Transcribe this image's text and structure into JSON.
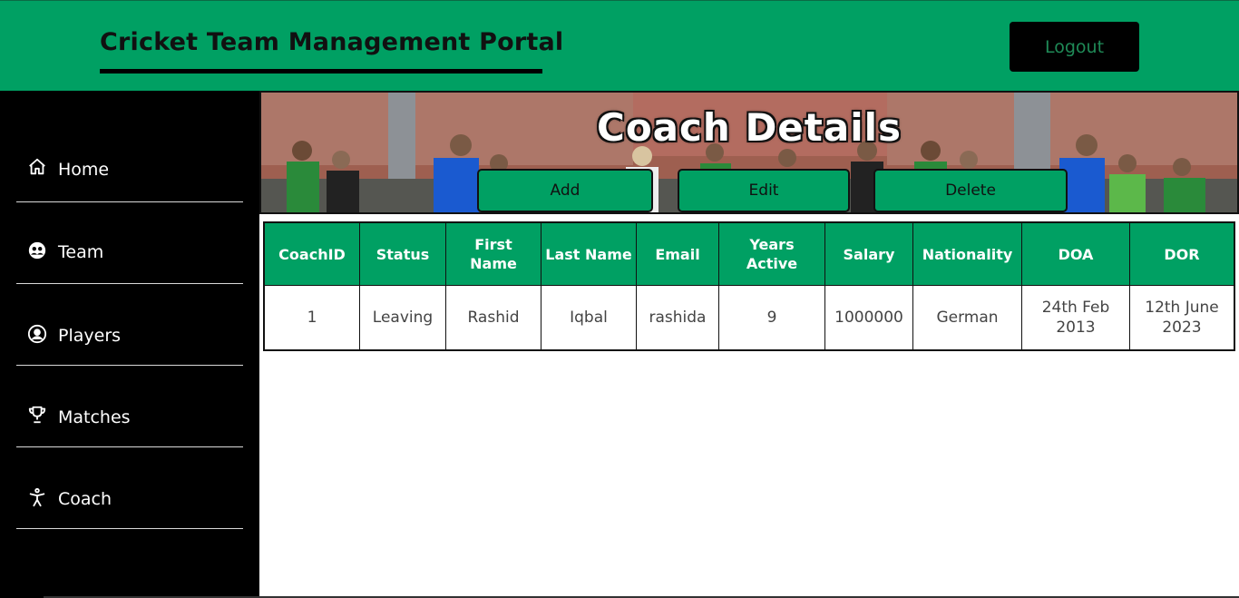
{
  "header": {
    "title": "Cricket Team Management Portal",
    "logout_label": "Logout",
    "brand_color": "#00a063"
  },
  "sidebar": {
    "items": [
      {
        "label": "Home",
        "icon": "home-icon"
      },
      {
        "label": "Team",
        "icon": "team-icon"
      },
      {
        "label": "Players",
        "icon": "user-circle-icon"
      },
      {
        "label": "Matches",
        "icon": "trophy-icon"
      },
      {
        "label": "Coach",
        "icon": "person-icon"
      }
    ]
  },
  "banner": {
    "title": "Coach Details",
    "buttons": {
      "add": "Add",
      "edit": "Edit",
      "delete": "Delete"
    }
  },
  "table": {
    "headers": [
      "CoachID",
      "Status",
      "First Name",
      "Last Name",
      "Email",
      "Years Active",
      "Salary",
      "Nationality",
      "DOA",
      "DOR"
    ],
    "rows": [
      [
        "1",
        "Leaving",
        "Rashid",
        "Iqbal",
        "rashida",
        "9",
        "1000000",
        "German",
        "24th Feb 2013",
        "12th June 2023"
      ]
    ]
  }
}
